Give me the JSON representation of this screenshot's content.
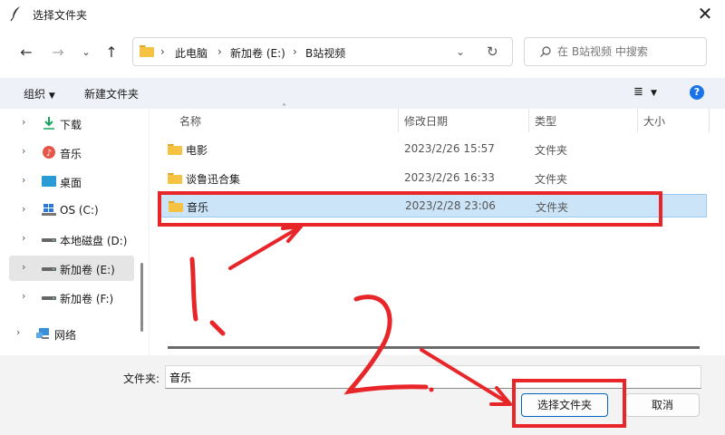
{
  "window": {
    "title": "选择文件夹"
  },
  "address": {
    "crumbs": [
      "此电脑",
      "新加卷 (E:)",
      "B站视频"
    ]
  },
  "search": {
    "placeholder": "在 B站视频 中搜索"
  },
  "toolbar": {
    "organize_label": "组织",
    "new_folder_label": "新建文件夹",
    "help_label": "?"
  },
  "sidebar": {
    "items": [
      {
        "label": "下载",
        "icon": "download-icon"
      },
      {
        "label": "音乐",
        "icon": "music-icon"
      },
      {
        "label": "桌面",
        "icon": "desktop-icon"
      },
      {
        "label": "OS (C:)",
        "icon": "windows-drive-icon"
      },
      {
        "label": "本地磁盘 (D:)",
        "icon": "drive-icon"
      },
      {
        "label": "新加卷 (E:)",
        "icon": "drive-icon",
        "selected": true
      },
      {
        "label": "新加卷 (F:)",
        "icon": "drive-icon"
      },
      {
        "label": "网络",
        "icon": "network-icon"
      }
    ]
  },
  "columns": {
    "name": "名称",
    "date": "修改日期",
    "type": "类型",
    "size": "大小"
  },
  "files": [
    {
      "name": "电影",
      "date": "2023/2/26 15:57",
      "type": "文件夹"
    },
    {
      "name": "谈鲁迅合集",
      "date": "2023/2/26 16:33",
      "type": "文件夹"
    },
    {
      "name": "音乐",
      "date": "2023/2/28 23:06",
      "type": "文件夹",
      "selected": true
    }
  ],
  "folder_field": {
    "label": "文件夹:",
    "value": "音乐"
  },
  "buttons": {
    "select_label": "选择文件夹",
    "cancel_label": "取消"
  },
  "colors": {
    "accent": "#0067c0",
    "selection": "#cce4f7",
    "annotation": "#e8262a",
    "folder": "#f5c242"
  },
  "annotations": {
    "step1": "1.",
    "step2": "2."
  }
}
